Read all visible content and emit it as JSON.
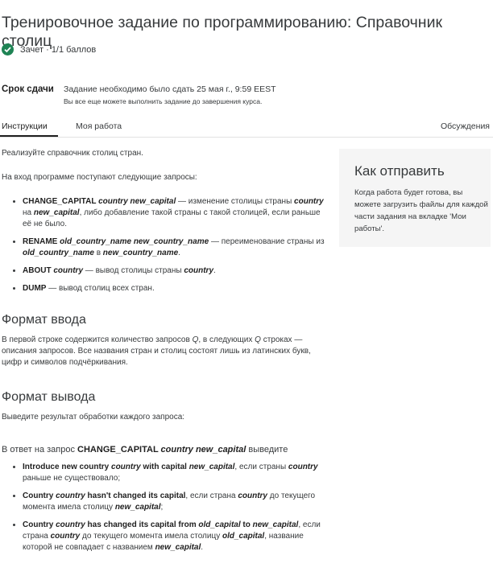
{
  "header": {
    "title": "Тренировочное задание по программированию: Справочник столиц",
    "status": "Зачет · 1/1 баллов"
  },
  "deadline": {
    "label": "Срок сдачи",
    "text": "Задание необходимо было сдать 25 мая г., 9:59 EEST",
    "note": "Вы все еще можете выполнить задание до завершения курса."
  },
  "tabs": {
    "instructions": "Инструкции",
    "my_work": "Моя работа",
    "discussions": "Обсуждения"
  },
  "sidebar": {
    "title": "Как отправить",
    "text": "Когда работа будет готова, вы можете загрузить файлы для каждой части задания на вкладке 'Мои работы'."
  },
  "content": {
    "intro": "Реализуйте справочник столиц стран.",
    "requests_intro": "На вход программе поступают следующие запросы:",
    "commands": [
      {
        "parts": [
          {
            "t": "CHANGE_CAPITAL ",
            "s": "b"
          },
          {
            "t": "country new_capital",
            "s": "bi"
          },
          {
            "t": " — изменение столицы страны ",
            "s": ""
          },
          {
            "t": "country",
            "s": "bi"
          },
          {
            "t": " на ",
            "s": ""
          },
          {
            "t": "new_capital",
            "s": "bi"
          },
          {
            "t": ", либо добавление такой страны с такой столицей, если раньше её не было.",
            "s": ""
          }
        ]
      },
      {
        "parts": [
          {
            "t": "RENAME ",
            "s": "b"
          },
          {
            "t": "old_country_name new_country_name",
            "s": "bi"
          },
          {
            "t": " — переименование страны из ",
            "s": ""
          },
          {
            "t": "old_country_name",
            "s": "bi"
          },
          {
            "t": " в ",
            "s": ""
          },
          {
            "t": "new_country_name",
            "s": "bi"
          },
          {
            "t": ".",
            "s": ""
          }
        ]
      },
      {
        "parts": [
          {
            "t": "ABOUT ",
            "s": "b"
          },
          {
            "t": "country",
            "s": "bi"
          },
          {
            "t": " — вывод столицы страны ",
            "s": ""
          },
          {
            "t": "country",
            "s": "bi"
          },
          {
            "t": ".",
            "s": ""
          }
        ]
      },
      {
        "parts": [
          {
            "t": "DUMP",
            "s": "b"
          },
          {
            "t": " — вывод столиц всех стран.",
            "s": ""
          }
        ]
      }
    ],
    "input_heading": "Формат ввода",
    "input_text": [
      {
        "t": "В первой строке содержится количество запросов ",
        "s": ""
      },
      {
        "t": "Q",
        "s": "i"
      },
      {
        "t": ", в следующих ",
        "s": ""
      },
      {
        "t": "Q",
        "s": "i"
      },
      {
        "t": " строках — описания запросов. Все названия стран и столиц состоят лишь из латинских букв, цифр и символов подчёркивания.",
        "s": ""
      }
    ],
    "output_heading": "Формат вывода",
    "output_text": "Выведите результат обработки каждого запроса:",
    "change_capital_intro": [
      {
        "t": "В ответ на запрос ",
        "s": ""
      },
      {
        "t": "CHANGE_CAPITAL ",
        "s": "b"
      },
      {
        "t": "country new_capital",
        "s": "bi"
      },
      {
        "t": " выведите",
        "s": ""
      }
    ],
    "responses": [
      {
        "parts": [
          {
            "t": "Introduce new country ",
            "s": "b"
          },
          {
            "t": "country",
            "s": "bi"
          },
          {
            "t": " with capital ",
            "s": "b"
          },
          {
            "t": "new_capital",
            "s": "bi"
          },
          {
            "t": ", если страны ",
            "s": ""
          },
          {
            "t": "country",
            "s": "bi"
          },
          {
            "t": " раньше не существовало;",
            "s": ""
          }
        ]
      },
      {
        "parts": [
          {
            "t": "Country ",
            "s": "b"
          },
          {
            "t": "country",
            "s": "bi"
          },
          {
            "t": " hasn't changed its capital",
            "s": "b"
          },
          {
            "t": ", если страна ",
            "s": ""
          },
          {
            "t": "country",
            "s": "bi"
          },
          {
            "t": " до текущего момента имела столицу ",
            "s": ""
          },
          {
            "t": "new_capital",
            "s": "bi"
          },
          {
            "t": ";",
            "s": ""
          }
        ]
      },
      {
        "parts": [
          {
            "t": "Country ",
            "s": "b"
          },
          {
            "t": "country",
            "s": "bi"
          },
          {
            "t": " has changed its capital from ",
            "s": "b"
          },
          {
            "t": "old_capital",
            "s": "bi"
          },
          {
            "t": " to ",
            "s": "b"
          },
          {
            "t": "new_capital",
            "s": "bi"
          },
          {
            "t": ", если страна ",
            "s": ""
          },
          {
            "t": "country",
            "s": "bi"
          },
          {
            "t": " до текущего момента имела столицу ",
            "s": ""
          },
          {
            "t": "old_capital",
            "s": "bi"
          },
          {
            "t": ", название которой не совпадает с названием ",
            "s": ""
          },
          {
            "t": "new_capital",
            "s": "bi"
          },
          {
            "t": ".",
            "s": ""
          }
        ]
      }
    ]
  },
  "colors": {
    "success": "#1f8354",
    "sidebar_bg": "#f5f5f5",
    "divider": "#e1e1e1"
  },
  "icons": {
    "status": "check-circle-icon"
  }
}
